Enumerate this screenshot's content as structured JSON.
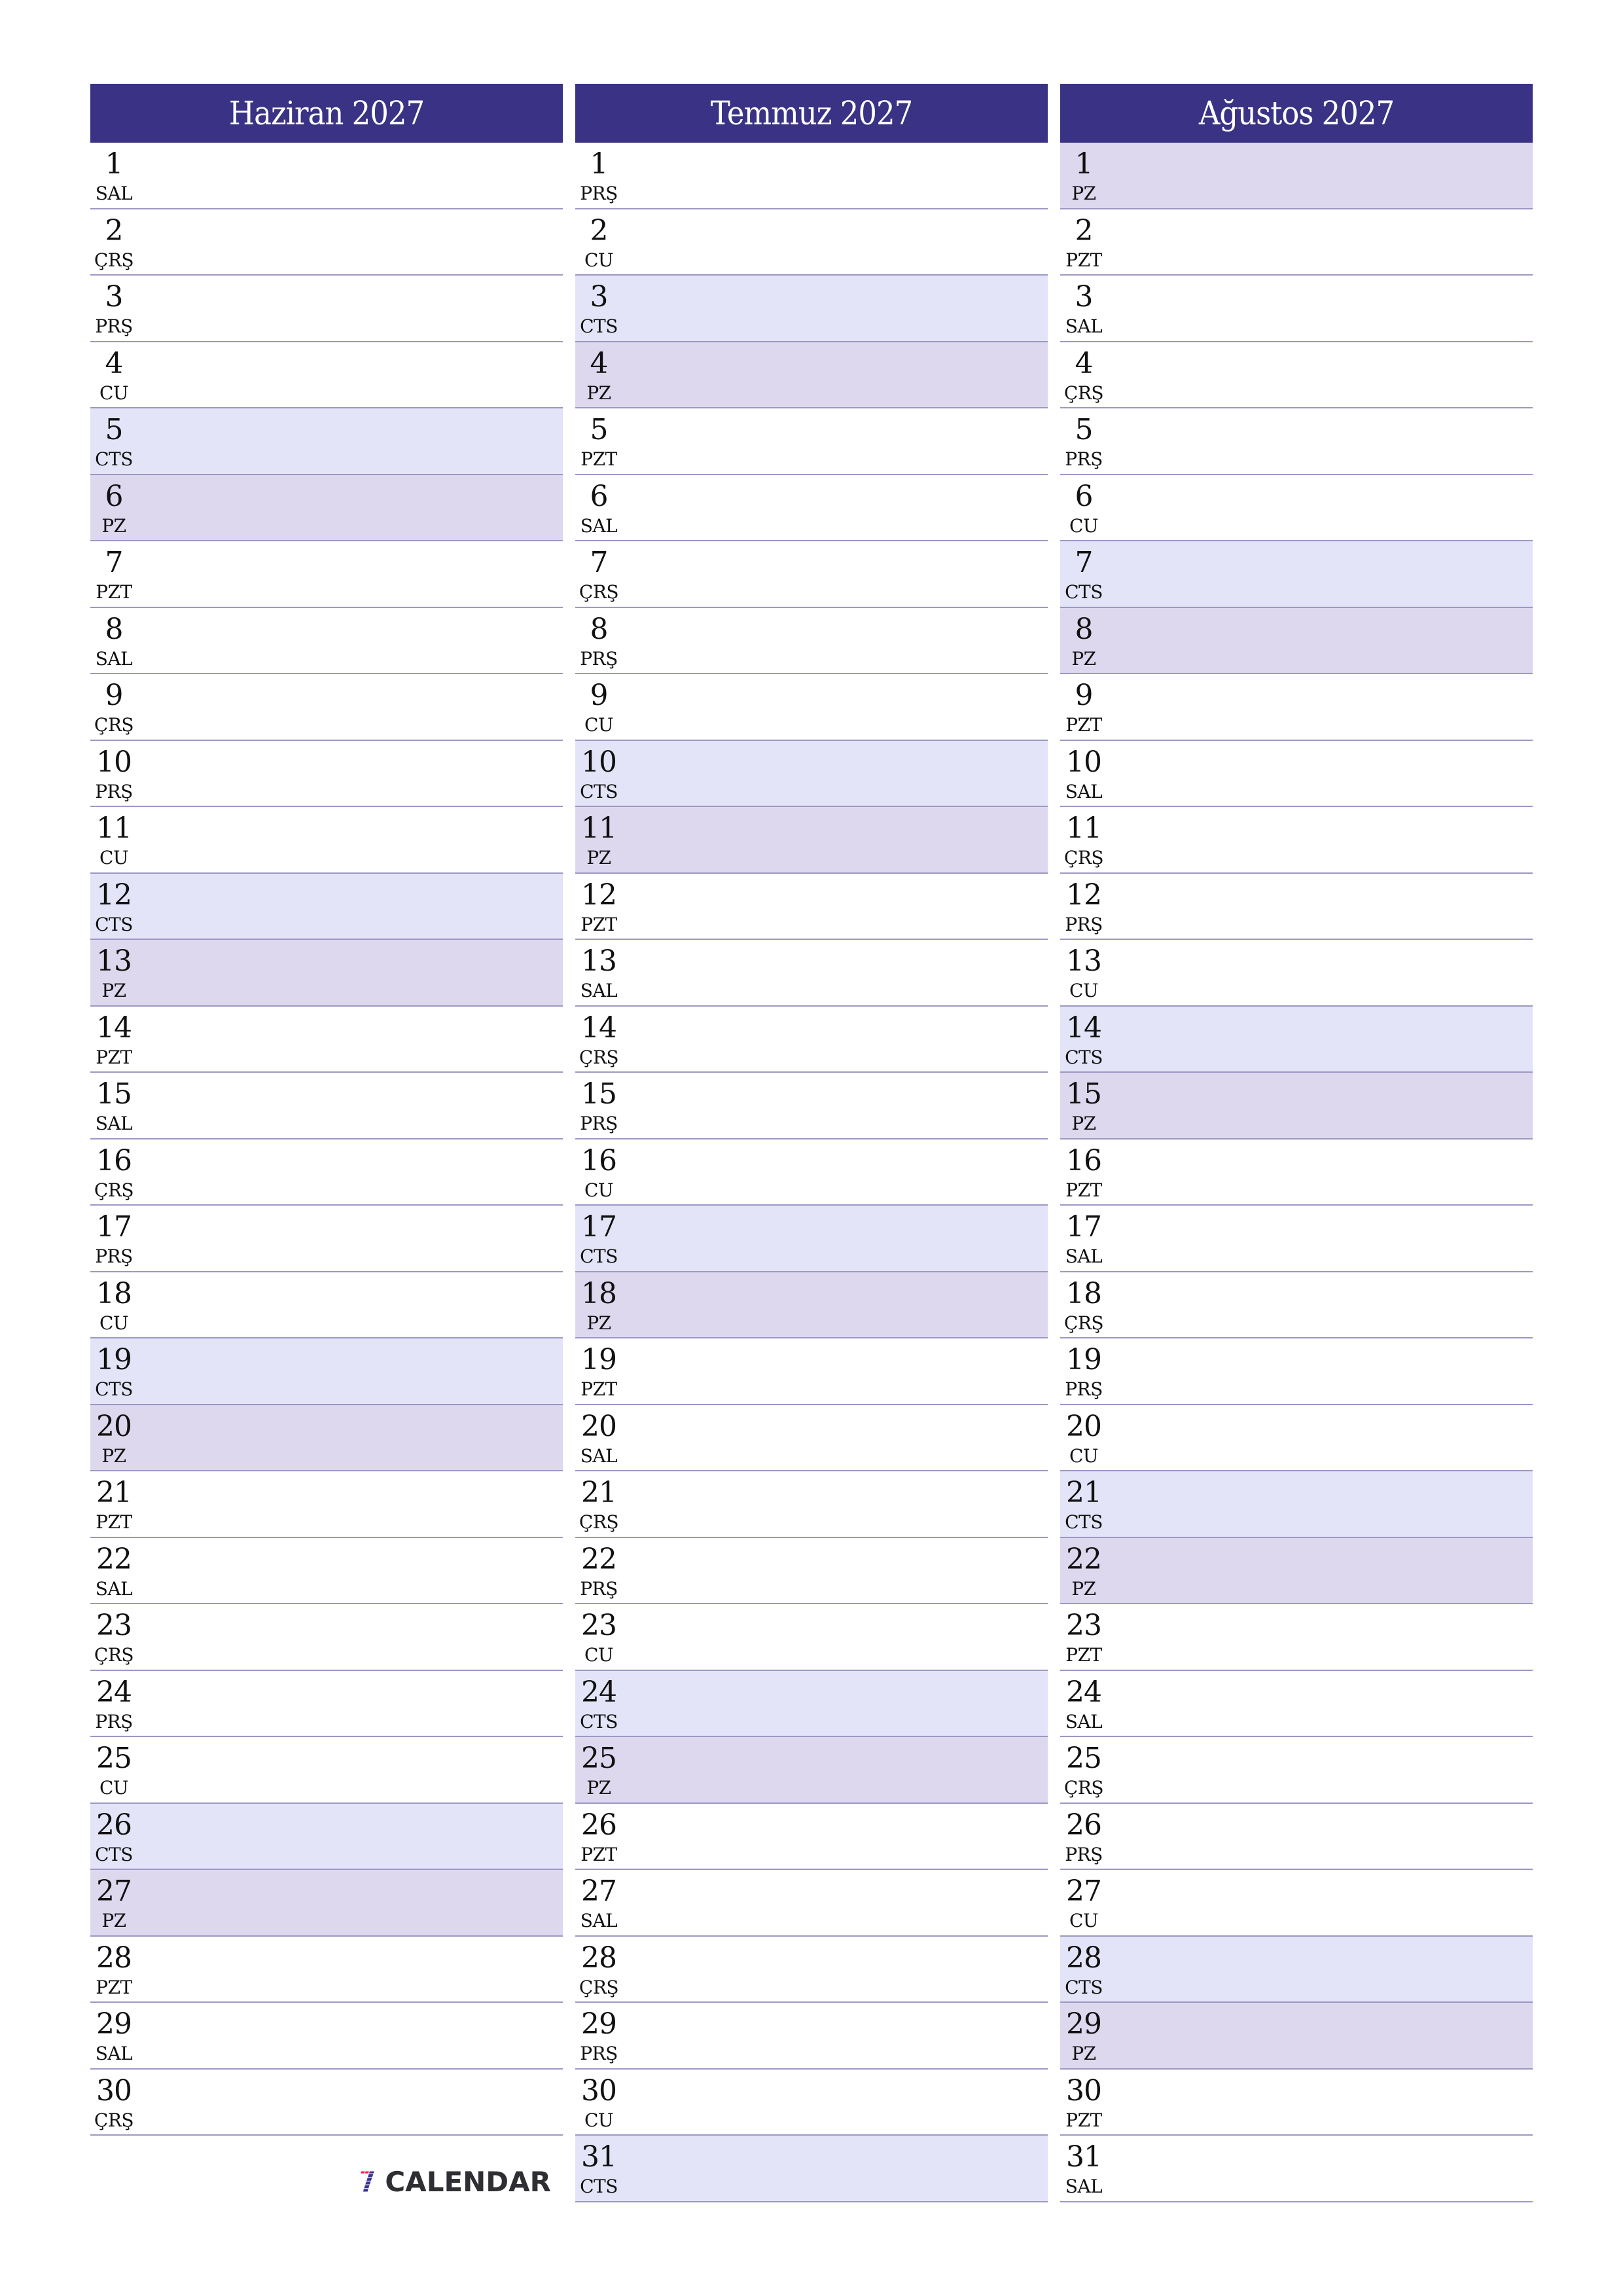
{
  "colors": {
    "header_bg": "#3a3284",
    "header_text": "#ffffff",
    "saturday_bg": "#e4e4f8",
    "sunday_bg": "#ddd8ee",
    "divider": "#9c98c4",
    "logo_red": "#ff1744",
    "logo_blue": "#3a3294"
  },
  "weekday_abbr": {
    "mon": "PZT",
    "tue": "SAL",
    "wed": "ÇRŞ",
    "thu": "PRŞ",
    "fri": "CU",
    "sat": "CTS",
    "sun": "PZ"
  },
  "months": [
    {
      "title": "Haziran 2027",
      "days": [
        {
          "n": "1",
          "dow": "SAL"
        },
        {
          "n": "2",
          "dow": "ÇRŞ"
        },
        {
          "n": "3",
          "dow": "PRŞ"
        },
        {
          "n": "4",
          "dow": "CU"
        },
        {
          "n": "5",
          "dow": "CTS",
          "type": "sat"
        },
        {
          "n": "6",
          "dow": "PZ",
          "type": "sun"
        },
        {
          "n": "7",
          "dow": "PZT"
        },
        {
          "n": "8",
          "dow": "SAL"
        },
        {
          "n": "9",
          "dow": "ÇRŞ"
        },
        {
          "n": "10",
          "dow": "PRŞ"
        },
        {
          "n": "11",
          "dow": "CU"
        },
        {
          "n": "12",
          "dow": "CTS",
          "type": "sat"
        },
        {
          "n": "13",
          "dow": "PZ",
          "type": "sun"
        },
        {
          "n": "14",
          "dow": "PZT"
        },
        {
          "n": "15",
          "dow": "SAL"
        },
        {
          "n": "16",
          "dow": "ÇRŞ"
        },
        {
          "n": "17",
          "dow": "PRŞ"
        },
        {
          "n": "18",
          "dow": "CU"
        },
        {
          "n": "19",
          "dow": "CTS",
          "type": "sat"
        },
        {
          "n": "20",
          "dow": "PZ",
          "type": "sun"
        },
        {
          "n": "21",
          "dow": "PZT"
        },
        {
          "n": "22",
          "dow": "SAL"
        },
        {
          "n": "23",
          "dow": "ÇRŞ"
        },
        {
          "n": "24",
          "dow": "PRŞ"
        },
        {
          "n": "25",
          "dow": "CU"
        },
        {
          "n": "26",
          "dow": "CTS",
          "type": "sat"
        },
        {
          "n": "27",
          "dow": "PZ",
          "type": "sun"
        },
        {
          "n": "28",
          "dow": "PZT"
        },
        {
          "n": "29",
          "dow": "SAL"
        },
        {
          "n": "30",
          "dow": "ÇRŞ"
        }
      ]
    },
    {
      "title": "Temmuz 2027",
      "days": [
        {
          "n": "1",
          "dow": "PRŞ"
        },
        {
          "n": "2",
          "dow": "CU"
        },
        {
          "n": "3",
          "dow": "CTS",
          "type": "sat"
        },
        {
          "n": "4",
          "dow": "PZ",
          "type": "sun"
        },
        {
          "n": "5",
          "dow": "PZT"
        },
        {
          "n": "6",
          "dow": "SAL"
        },
        {
          "n": "7",
          "dow": "ÇRŞ"
        },
        {
          "n": "8",
          "dow": "PRŞ"
        },
        {
          "n": "9",
          "dow": "CU"
        },
        {
          "n": "10",
          "dow": "CTS",
          "type": "sat"
        },
        {
          "n": "11",
          "dow": "PZ",
          "type": "sun"
        },
        {
          "n": "12",
          "dow": "PZT"
        },
        {
          "n": "13",
          "dow": "SAL"
        },
        {
          "n": "14",
          "dow": "ÇRŞ"
        },
        {
          "n": "15",
          "dow": "PRŞ"
        },
        {
          "n": "16",
          "dow": "CU"
        },
        {
          "n": "17",
          "dow": "CTS",
          "type": "sat"
        },
        {
          "n": "18",
          "dow": "PZ",
          "type": "sun"
        },
        {
          "n": "19",
          "dow": "PZT"
        },
        {
          "n": "20",
          "dow": "SAL"
        },
        {
          "n": "21",
          "dow": "ÇRŞ"
        },
        {
          "n": "22",
          "dow": "PRŞ"
        },
        {
          "n": "23",
          "dow": "CU"
        },
        {
          "n": "24",
          "dow": "CTS",
          "type": "sat"
        },
        {
          "n": "25",
          "dow": "PZ",
          "type": "sun"
        },
        {
          "n": "26",
          "dow": "PZT"
        },
        {
          "n": "27",
          "dow": "SAL"
        },
        {
          "n": "28",
          "dow": "ÇRŞ"
        },
        {
          "n": "29",
          "dow": "PRŞ"
        },
        {
          "n": "30",
          "dow": "CU"
        },
        {
          "n": "31",
          "dow": "CTS",
          "type": "sat"
        }
      ]
    },
    {
      "title": "Ağustos 2027",
      "days": [
        {
          "n": "1",
          "dow": "PZ",
          "type": "sun"
        },
        {
          "n": "2",
          "dow": "PZT"
        },
        {
          "n": "3",
          "dow": "SAL"
        },
        {
          "n": "4",
          "dow": "ÇRŞ"
        },
        {
          "n": "5",
          "dow": "PRŞ"
        },
        {
          "n": "6",
          "dow": "CU"
        },
        {
          "n": "7",
          "dow": "CTS",
          "type": "sat"
        },
        {
          "n": "8",
          "dow": "PZ",
          "type": "sun"
        },
        {
          "n": "9",
          "dow": "PZT"
        },
        {
          "n": "10",
          "dow": "SAL"
        },
        {
          "n": "11",
          "dow": "ÇRŞ"
        },
        {
          "n": "12",
          "dow": "PRŞ"
        },
        {
          "n": "13",
          "dow": "CU"
        },
        {
          "n": "14",
          "dow": "CTS",
          "type": "sat"
        },
        {
          "n": "15",
          "dow": "PZ",
          "type": "sun"
        },
        {
          "n": "16",
          "dow": "PZT"
        },
        {
          "n": "17",
          "dow": "SAL"
        },
        {
          "n": "18",
          "dow": "ÇRŞ"
        },
        {
          "n": "19",
          "dow": "PRŞ"
        },
        {
          "n": "20",
          "dow": "CU"
        },
        {
          "n": "21",
          "dow": "CTS",
          "type": "sat"
        },
        {
          "n": "22",
          "dow": "PZ",
          "type": "sun"
        },
        {
          "n": "23",
          "dow": "PZT"
        },
        {
          "n": "24",
          "dow": "SAL"
        },
        {
          "n": "25",
          "dow": "ÇRŞ"
        },
        {
          "n": "26",
          "dow": "PRŞ"
        },
        {
          "n": "27",
          "dow": "CU"
        },
        {
          "n": "28",
          "dow": "CTS",
          "type": "sat"
        },
        {
          "n": "29",
          "dow": "PZ",
          "type": "sun"
        },
        {
          "n": "30",
          "dow": "PZT"
        },
        {
          "n": "31",
          "dow": "SAL"
        }
      ]
    }
  ],
  "logo": {
    "text": "CALENDAR",
    "icon": "seven-calendar-logo-icon"
  }
}
